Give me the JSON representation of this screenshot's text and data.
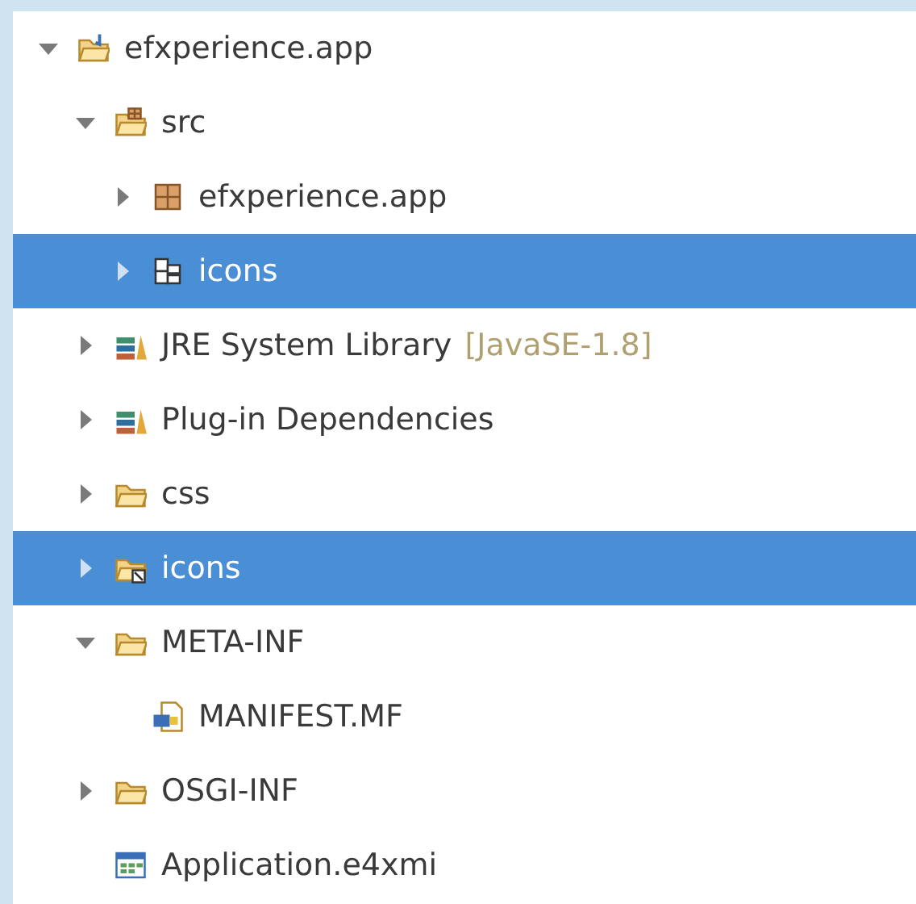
{
  "tree": [
    {
      "kind": "project",
      "label": "efxperience.app",
      "expanded": true,
      "selected": false,
      "children": [
        {
          "kind": "source-folder",
          "label": "src",
          "expanded": true,
          "selected": false,
          "children": [
            {
              "kind": "package",
              "label": "efxperience.app",
              "expanded": false,
              "selected": false
            },
            {
              "kind": "package-resources",
              "label": "icons",
              "expanded": false,
              "selected": true
            }
          ]
        },
        {
          "kind": "library",
          "label": "JRE System Library",
          "decoration": "[JavaSE-1.8]",
          "expanded": false,
          "selected": false
        },
        {
          "kind": "library",
          "label": "Plug-in Dependencies",
          "expanded": false,
          "selected": false
        },
        {
          "kind": "folder",
          "label": "css",
          "expanded": false,
          "selected": false
        },
        {
          "kind": "linked-folder",
          "label": "icons",
          "expanded": false,
          "selected": true
        },
        {
          "kind": "folder",
          "label": "META-INF",
          "expanded": true,
          "selected": false,
          "children": [
            {
              "kind": "manifest",
              "label": "MANIFEST.MF",
              "selected": false
            }
          ]
        },
        {
          "kind": "folder",
          "label": "OSGI-INF",
          "expanded": false,
          "selected": false
        },
        {
          "kind": "model",
          "label": "Application.e4xmi",
          "selected": false
        }
      ]
    }
  ]
}
